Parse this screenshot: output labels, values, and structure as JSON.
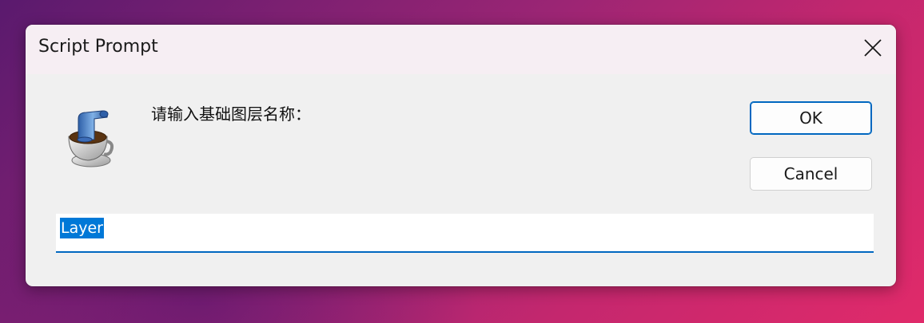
{
  "dialog": {
    "title": "Script Prompt",
    "prompt": "请输入基础图层名称：",
    "input_value": "Layer",
    "ok_label": "OK",
    "cancel_label": "Cancel",
    "icon": "script-editor-icon",
    "close_icon": "close-icon"
  },
  "colors": {
    "accent": "#0067c0",
    "selection": "#0078d7",
    "dialog_bg": "#f0f0f0"
  }
}
